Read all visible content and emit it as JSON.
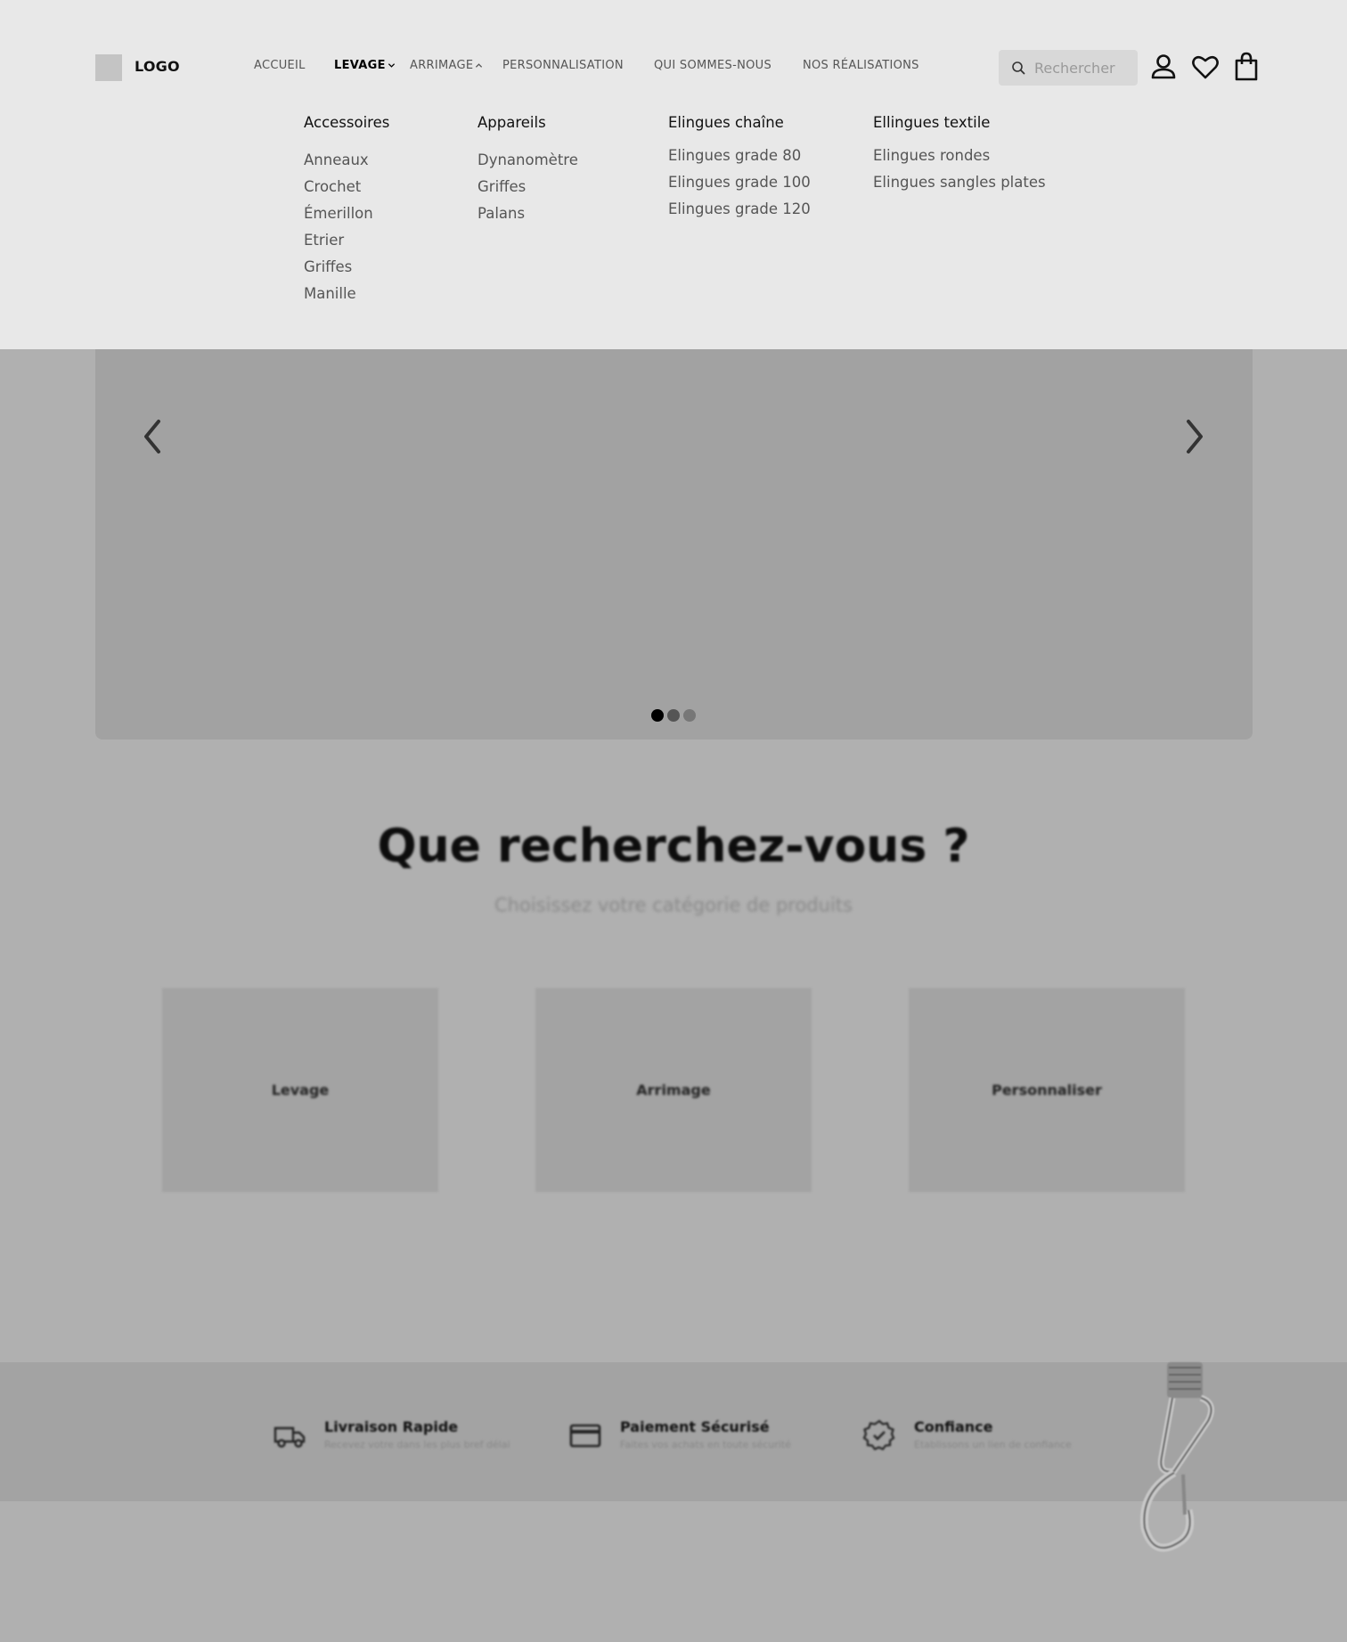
{
  "header": {
    "logo_text": "LOGO",
    "nav": [
      {
        "label": "ACCUEIL"
      },
      {
        "label": "LEVAGE"
      },
      {
        "label": "ARRIMAGE"
      },
      {
        "label": "PERSONNALISATION"
      },
      {
        "label": "QUI SOMMES-NOUS"
      },
      {
        "label": "NOS RÉALISATIONS"
      }
    ],
    "search_placeholder": "Rechercher",
    "icons": [
      "search-icon",
      "user-icon",
      "heart-icon",
      "cart-icon"
    ]
  },
  "mega_menu": {
    "columns": [
      {
        "title": "Accessoires",
        "links": [
          "Anneaux",
          "Crochet",
          "Émerillon",
          "Etrier",
          "Griffes",
          "Manille"
        ]
      },
      {
        "title": "Appareils",
        "links": [
          "Dynanomètre",
          "Griffes",
          "Palans"
        ]
      },
      {
        "title": "Elingues chaîne",
        "links": [
          "Elingues grade 80",
          "Elingues grade 100",
          "Elingues grade 120"
        ]
      },
      {
        "title": "Ellingues textile",
        "links": [
          "Elingues rondes",
          "Elingues sangles plates"
        ]
      }
    ]
  },
  "hero": {
    "slides_count": 3,
    "active_slide": 1
  },
  "categories": {
    "title": "Que recherchez-vous ?",
    "subtitle": "Choisissez votre catégorie de produits",
    "items": [
      {
        "label": "Levage"
      },
      {
        "label": "Arrimage"
      },
      {
        "label": "Personnaliser"
      }
    ]
  },
  "features": [
    {
      "title": "Livraison Rapide",
      "desc": "Recevez votre dans les plus bref délai",
      "icon": "truck-icon"
    },
    {
      "title": "Paiement Sécurisé",
      "desc": "Faites vos achats en toute sécurité",
      "icon": "credit-card-icon"
    },
    {
      "title": "Confiance",
      "desc": "Etablissons un lien de confiance",
      "icon": "verified-badge-icon"
    }
  ],
  "colors": {
    "header_bg": "#e8e8e8",
    "overlay_bg": "#b0b0b0",
    "hero_bg": "#a2a2a2",
    "active_dot": "#000000"
  }
}
